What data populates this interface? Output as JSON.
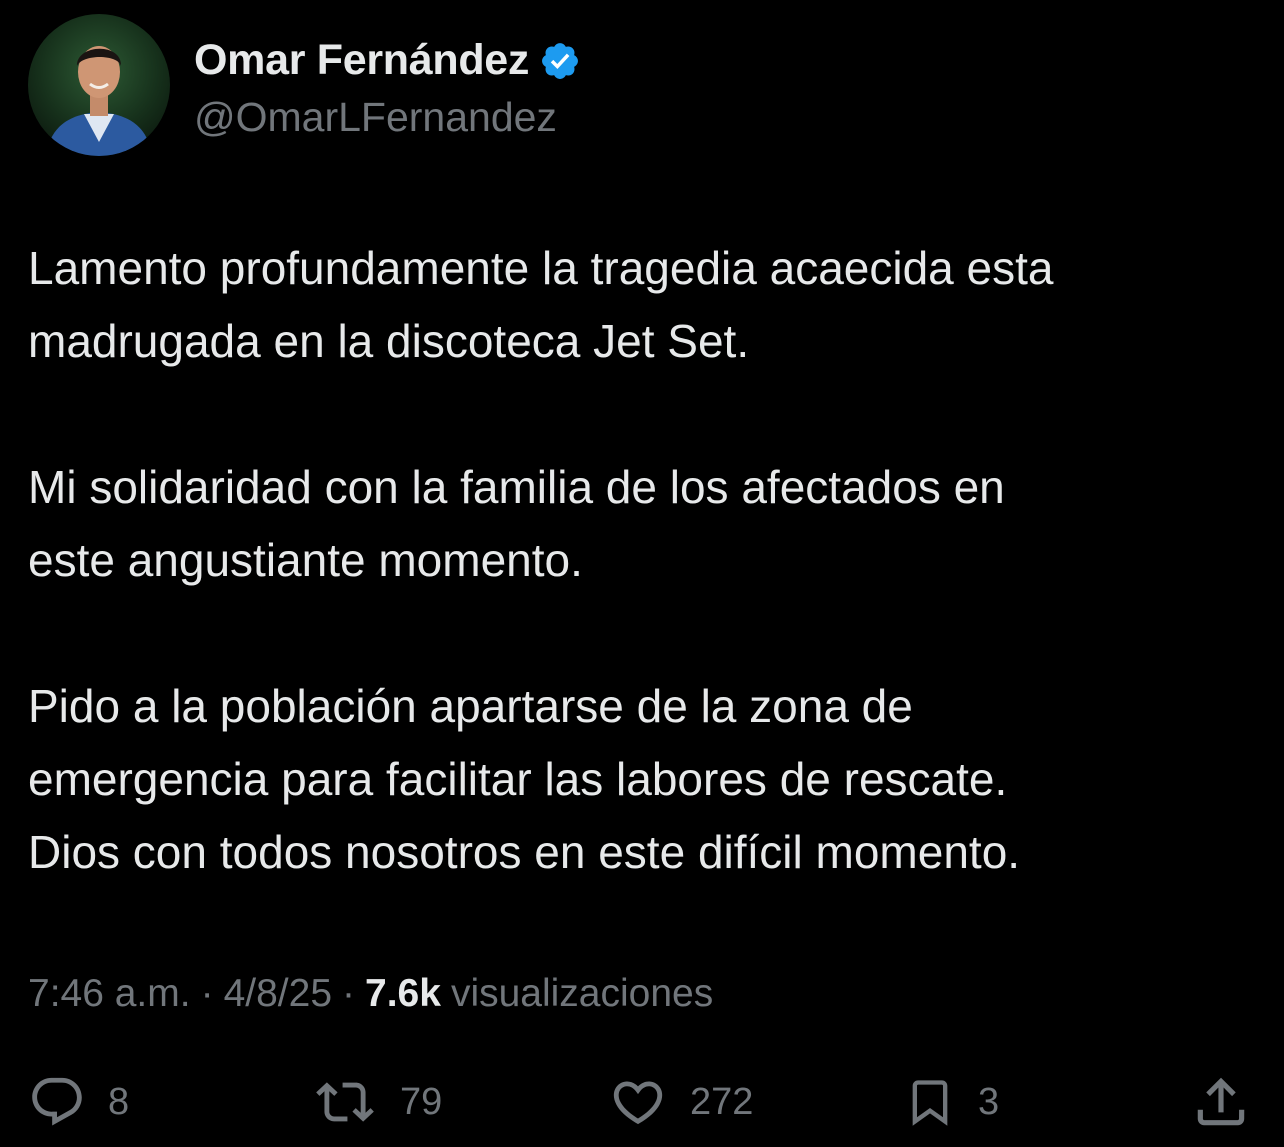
{
  "colors": {
    "background": "#000000",
    "primary_text": "#e7e9ea",
    "secondary_text": "#71767b",
    "verified_badge": "#1d9bf0"
  },
  "author": {
    "display_name": "Omar Fernández",
    "handle": "@OmarLFernandez",
    "verified": true
  },
  "tweet": {
    "paragraphs": [
      "Lamento profundamente la tragedia acaecida esta\nmadrugada en la discoteca Jet Set.",
      "Mi solidaridad con la familia de los afectados en\neste angustiante momento.",
      "Pido a la población apartarse de la zona de\nemergencia para facilitar las labores de rescate.\nDios con todos nosotros en este difícil momento."
    ]
  },
  "meta": {
    "time": "7:46 a.m.",
    "separator": "·",
    "date": "4/8/25",
    "views_count": "7.6k",
    "views_label": "visualizaciones"
  },
  "actions": {
    "reply": {
      "icon": "reply-icon",
      "count": "8"
    },
    "repost": {
      "icon": "repost-icon",
      "count": "79"
    },
    "like": {
      "icon": "heart-icon",
      "count": "272"
    },
    "bookmark": {
      "icon": "bookmark-icon",
      "count": "3"
    },
    "share": {
      "icon": "share-icon"
    }
  }
}
